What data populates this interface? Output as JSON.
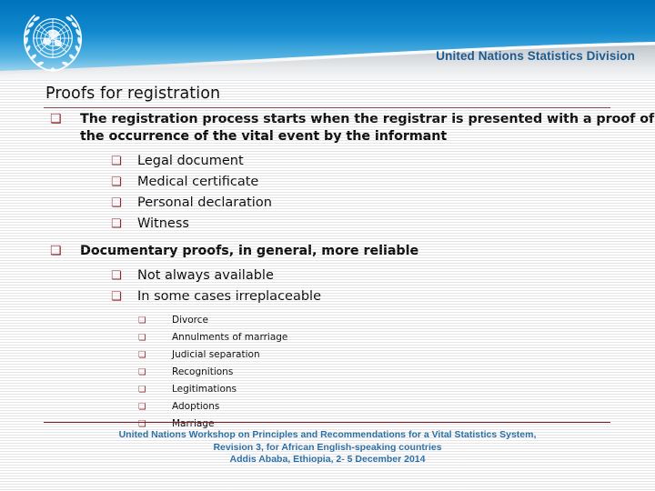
{
  "header": {
    "organization": "United Nations Statistics Division",
    "emblem_name": "un-emblem-icon",
    "gradient_top_color": "#0073bd",
    "gradient_bottom_color": "#cfe6f4",
    "title_text_color": "#1c5b90"
  },
  "slide": {
    "title": "Proofs for registration",
    "rule_color": "#7b1b24",
    "bullet_color": "#8a1b20",
    "bullet_glyph": "❏",
    "bullet_icon_name": "square-bullet-icon",
    "body": [
      {
        "level": 1,
        "text": "The registration process starts when the registrar is presented with a proof of the occurrence of the vital event by the informant"
      },
      {
        "level": 2,
        "text": "Legal document"
      },
      {
        "level": 2,
        "text": "Medical certificate"
      },
      {
        "level": 2,
        "text": "Personal declaration"
      },
      {
        "level": 2,
        "text": "Witness"
      },
      {
        "level": 1,
        "text": "Documentary proofs, in general, more reliable"
      },
      {
        "level": 2,
        "text": "Not always available"
      },
      {
        "level": 2,
        "text": "In some cases irreplaceable"
      },
      {
        "level": 3,
        "text": "Divorce"
      },
      {
        "level": 3,
        "text": "Annulments of marriage"
      },
      {
        "level": 3,
        "text": "Judicial separation"
      },
      {
        "level": 3,
        "text": "Recognitions"
      },
      {
        "level": 3,
        "text": "Legitimations"
      },
      {
        "level": 3,
        "text": "Adoptions"
      },
      {
        "level": 3,
        "text": "Marriage"
      }
    ]
  },
  "footer": {
    "line1": "United Nations Workshop on Principles and Recommendations for a Vital Statistics System,",
    "line2": "Revision 3, for African English-speaking countries",
    "line3": "Addis Ababa, Ethiopia, 2- 5 December 2014",
    "text_color": "#1f6aa5"
  }
}
